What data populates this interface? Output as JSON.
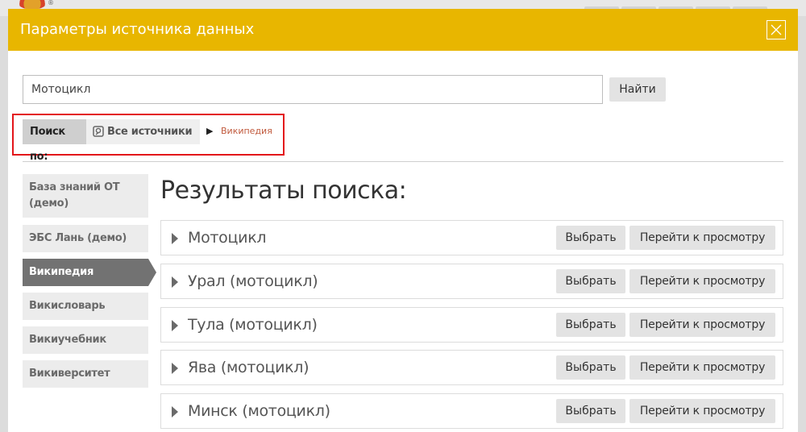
{
  "modal": {
    "title": "Параметры источника данных"
  },
  "search": {
    "value": "Мотоцикл",
    "button_label": "Найти"
  },
  "search_by": {
    "label": "Поиск по:",
    "all_sources": "Все источники",
    "crumb_arrow": "▶",
    "current": "Википедия"
  },
  "sidebar": {
    "items": [
      {
        "label": "База знаний ОТ (демо)",
        "active": false
      },
      {
        "label": "ЭБС Лань (демо)",
        "active": false
      },
      {
        "label": "Википедия",
        "active": true
      },
      {
        "label": "Викисловарь",
        "active": false
      },
      {
        "label": "Викиучебник",
        "active": false
      },
      {
        "label": "Викиверситет",
        "active": false
      }
    ]
  },
  "results": {
    "title": "Результаты поиска:",
    "items": [
      {
        "name": "Мотоцикл",
        "choose_label": "Выбрать",
        "view_label": "Перейти к просмотру"
      },
      {
        "name": "Урал (мотоцикл)",
        "choose_label": "Выбрать",
        "view_label": "Перейти к просмотру"
      },
      {
        "name": "Тула (мотоцикл)",
        "choose_label": "Выбрать",
        "view_label": "Перейти к просмотру"
      },
      {
        "name": "Ява (мотоцикл)",
        "choose_label": "Выбрать",
        "view_label": "Перейти к просмотру"
      },
      {
        "name": "Минск (мотоцикл)",
        "choose_label": "Выбрать",
        "view_label": "Перейти к просмотру"
      }
    ]
  },
  "background": {
    "reg_mark": "®"
  },
  "colors": {
    "header": "#e8b600",
    "highlight_border": "#e3151a",
    "active_item": "#727272",
    "crumb_link": "#c0593c"
  },
  "icons": {
    "close": "close-icon",
    "sources": "sources-icon",
    "expand": "expand-triangle-icon"
  }
}
